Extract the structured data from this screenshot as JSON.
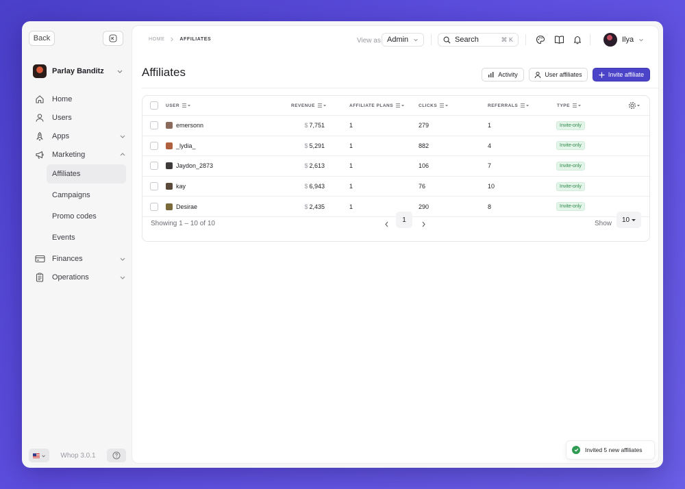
{
  "sidebar": {
    "back_label": "Back",
    "brand_name": "Parlay Banditz",
    "items": [
      {
        "label": "Home",
        "icon": "home-icon"
      },
      {
        "label": "Users",
        "icon": "user-icon"
      },
      {
        "label": "Apps",
        "icon": "rocket-icon"
      },
      {
        "label": "Marketing",
        "icon": "megaphone-icon"
      }
    ],
    "marketing_sub": [
      "Affiliates",
      "Campaigns",
      "Promo codes",
      "Events"
    ],
    "items_after": [
      {
        "label": "Finances",
        "icon": "card-icon"
      },
      {
        "label": "Operations",
        "icon": "clipboard-icon"
      }
    ],
    "version": "Whop 3.0.1"
  },
  "header": {
    "breadcrumb_home": "HOME",
    "breadcrumb_current": "AFFILIATES",
    "view_as_label": "View as",
    "view_as_value": "Admin",
    "search_label": "Search",
    "search_shortcut": "⌘ K",
    "user_name": "Ilya"
  },
  "page": {
    "title": "Affiliates",
    "activity_label": "Activity",
    "user_affiliates_label": "User affiliates",
    "invite_label": "Invite affiliate"
  },
  "table": {
    "columns": [
      "USER",
      "REVENUE",
      "AFFILIATE PLANS",
      "CLICKS",
      "REFERRALS",
      "TYPE"
    ],
    "currency": "$",
    "rows": [
      {
        "user": "emersonn",
        "revenue": "7,751",
        "plans": "1",
        "clicks": "279",
        "referrals": "1",
        "type": "Invite-only",
        "avatar_color": "#8a6a5a"
      },
      {
        "user": "_lydia_",
        "revenue": "5,291",
        "plans": "1",
        "clicks": "882",
        "referrals": "4",
        "type": "Invite-only",
        "avatar_color": "#b0603c"
      },
      {
        "user": "Jaydon_2873",
        "revenue": "2,613",
        "plans": "1",
        "clicks": "106",
        "referrals": "7",
        "type": "Invite-only",
        "avatar_color": "#3e3a3a"
      },
      {
        "user": "kay",
        "revenue": "6,943",
        "plans": "1",
        "clicks": "76",
        "referrals": "10",
        "type": "Invite-only",
        "avatar_color": "#5a4a3a"
      },
      {
        "user": "Desirae",
        "revenue": "2,435",
        "plans": "1",
        "clicks": "290",
        "referrals": "8",
        "type": "Invite-only",
        "avatar_color": "#7a6a3a"
      }
    ],
    "showing": "Showing 1 – 10 of 10",
    "current_page": "1",
    "show_label": "Show",
    "show_value": "10"
  },
  "toast": {
    "message": "Invited 5 new affiliates"
  },
  "colors": {
    "accent": "#4b44c9",
    "badge_green": "#2f8a4a",
    "background": "#5e4fe0"
  }
}
